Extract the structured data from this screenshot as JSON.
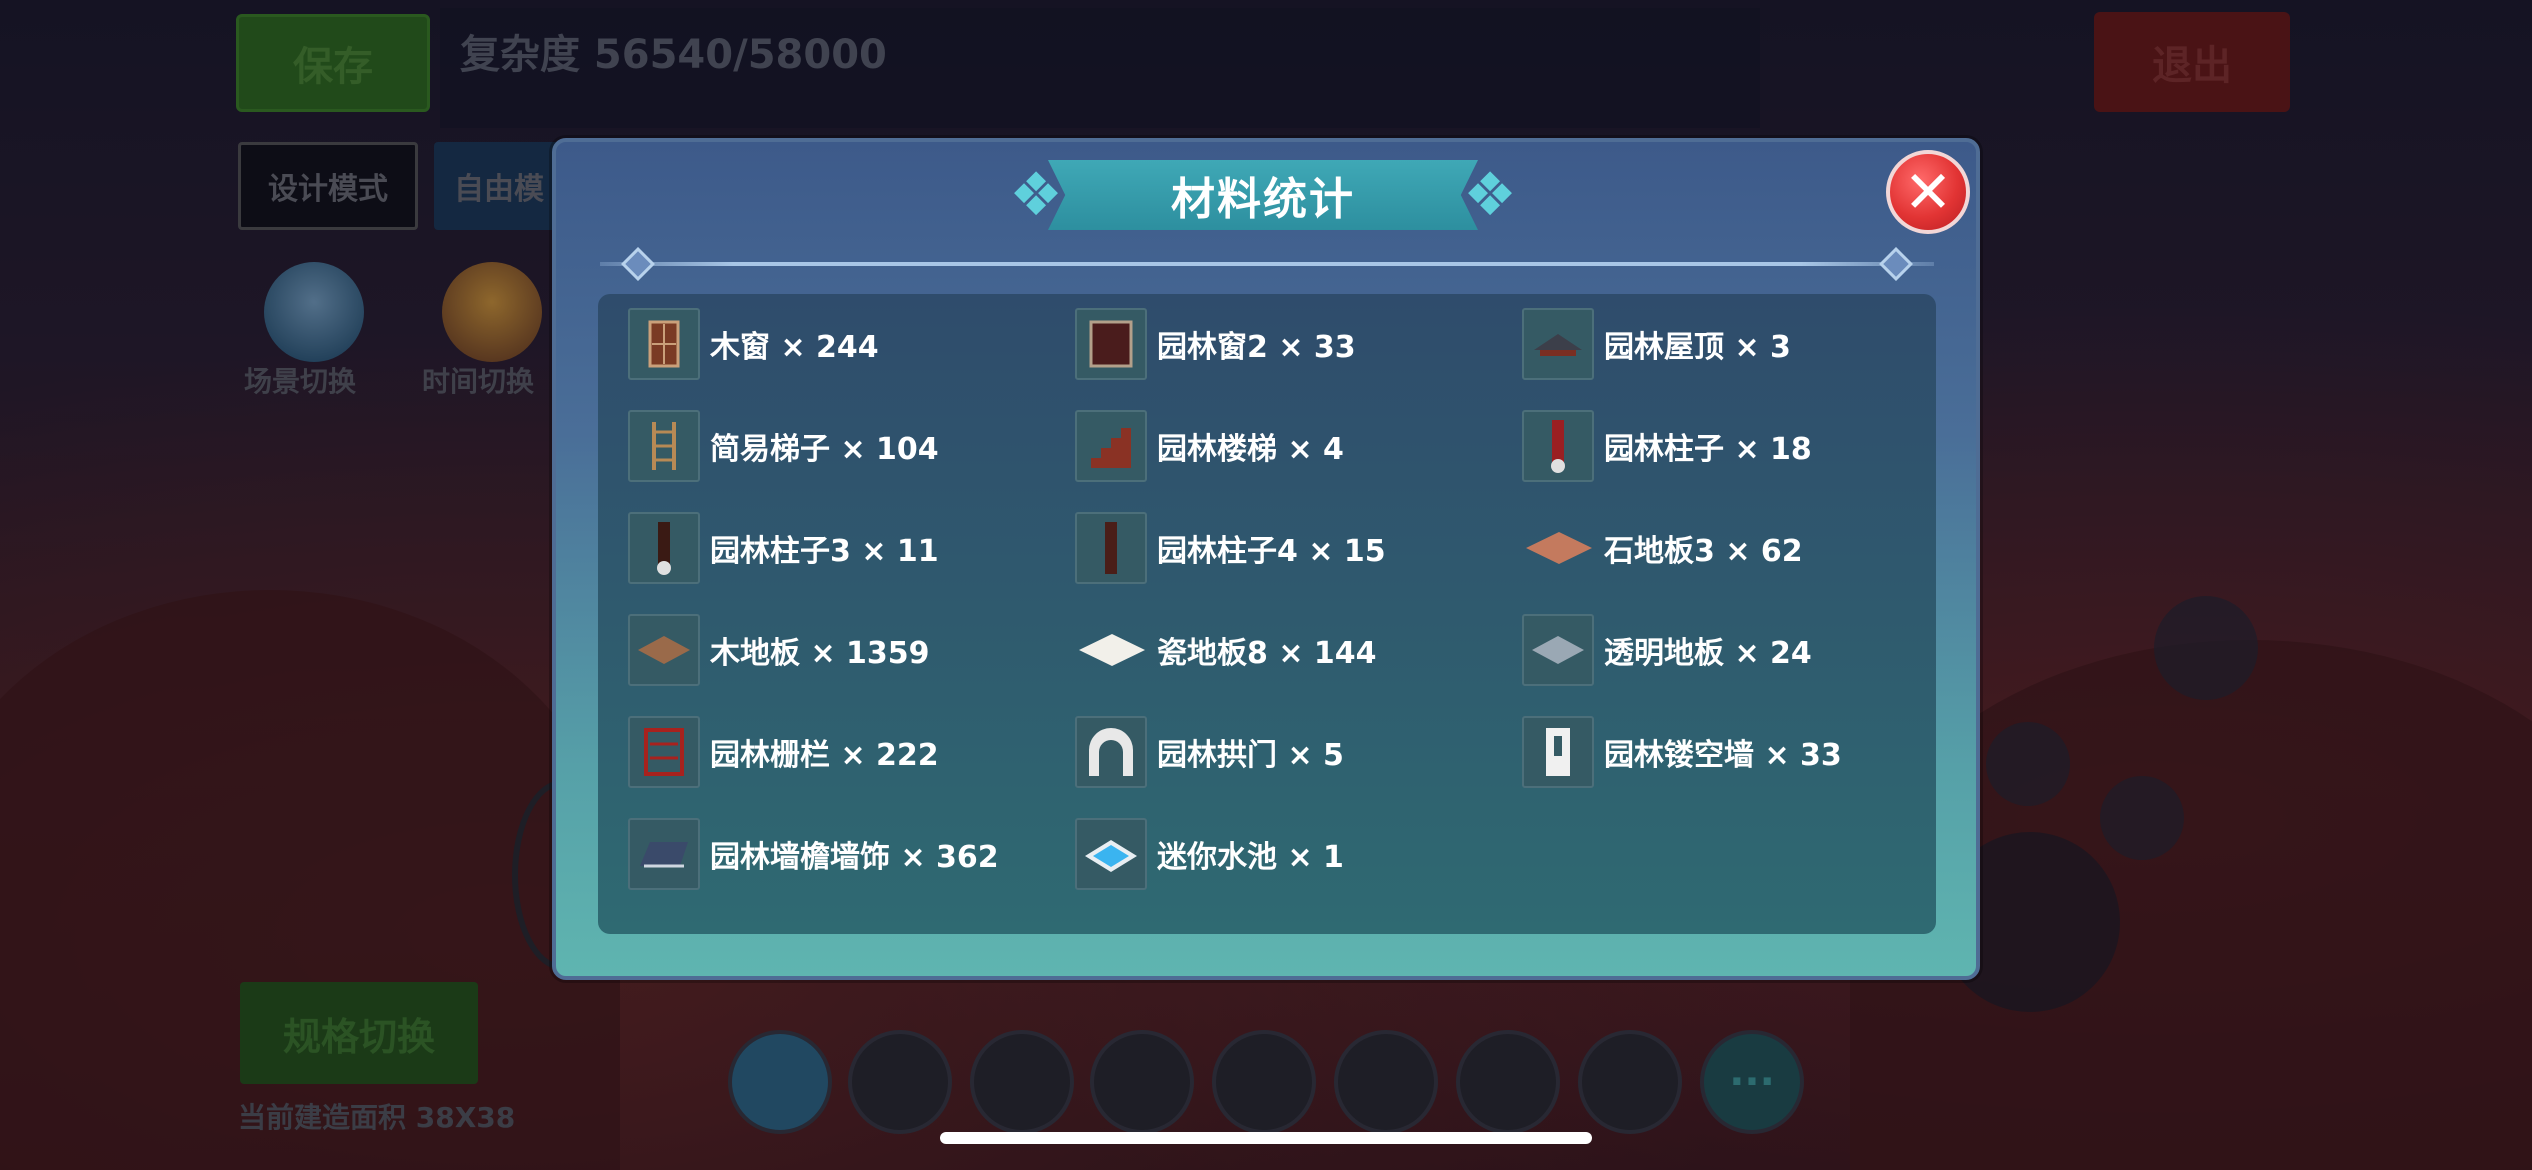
{
  "background": {
    "save_label": "保存",
    "complexity_label": "复杂度 56540/58000",
    "exit_label": "退出",
    "mode_design_label": "设计模式",
    "mode_free_label": "自由模",
    "scene_switch_label": "场景切换",
    "time_switch_label": "时间切换",
    "spec_switch_label": "规格切换",
    "build_area_label": "当前建造面积 38X38",
    "more_label": "···"
  },
  "modal": {
    "title": "材料统计",
    "close_label": "✕",
    "items": [
      {
        "label": "木窗 × 244",
        "icon": "wooden-window-icon"
      },
      {
        "label": "园林窗2 × 33",
        "icon": "garden-window-icon"
      },
      {
        "label": "园林屋顶 × 3",
        "icon": "garden-roof-icon"
      },
      {
        "label": "简易梯子 × 104",
        "icon": "ladder-icon"
      },
      {
        "label": "园林楼梯 × 4",
        "icon": "garden-stairs-icon"
      },
      {
        "label": "园林柱子 × 18",
        "icon": "garden-pillar-icon"
      },
      {
        "label": "园林柱子3 × 11",
        "icon": "garden-pillar3-icon"
      },
      {
        "label": "园林柱子4 × 15",
        "icon": "garden-pillar4-icon"
      },
      {
        "label": "石地板3 × 62",
        "icon": "stone-floor-icon"
      },
      {
        "label": "木地板 × 1359",
        "icon": "wood-floor-icon"
      },
      {
        "label": "瓷地板8 × 144",
        "icon": "ceramic-floor-icon"
      },
      {
        "label": "透明地板 × 24",
        "icon": "transparent-floor-icon"
      },
      {
        "label": "园林栅栏 × 222",
        "icon": "garden-fence-icon"
      },
      {
        "label": "园林拱门 × 5",
        "icon": "garden-arch-icon"
      },
      {
        "label": "园林镂空墙 × 33",
        "icon": "garden-hollow-wall-icon"
      },
      {
        "label": "园林墙檐墙饰 × 362",
        "icon": "garden-wall-eave-icon"
      },
      {
        "label": "迷你水池 × 1",
        "icon": "mini-pool-icon"
      }
    ]
  },
  "colors": {
    "save": "#2f6e1e",
    "exit": "#6e1a16",
    "close": "#e23434",
    "modal_top": "#3d5a8a",
    "modal_bottom": "#5fb5b0",
    "title_banner": "#3fa8b6"
  }
}
